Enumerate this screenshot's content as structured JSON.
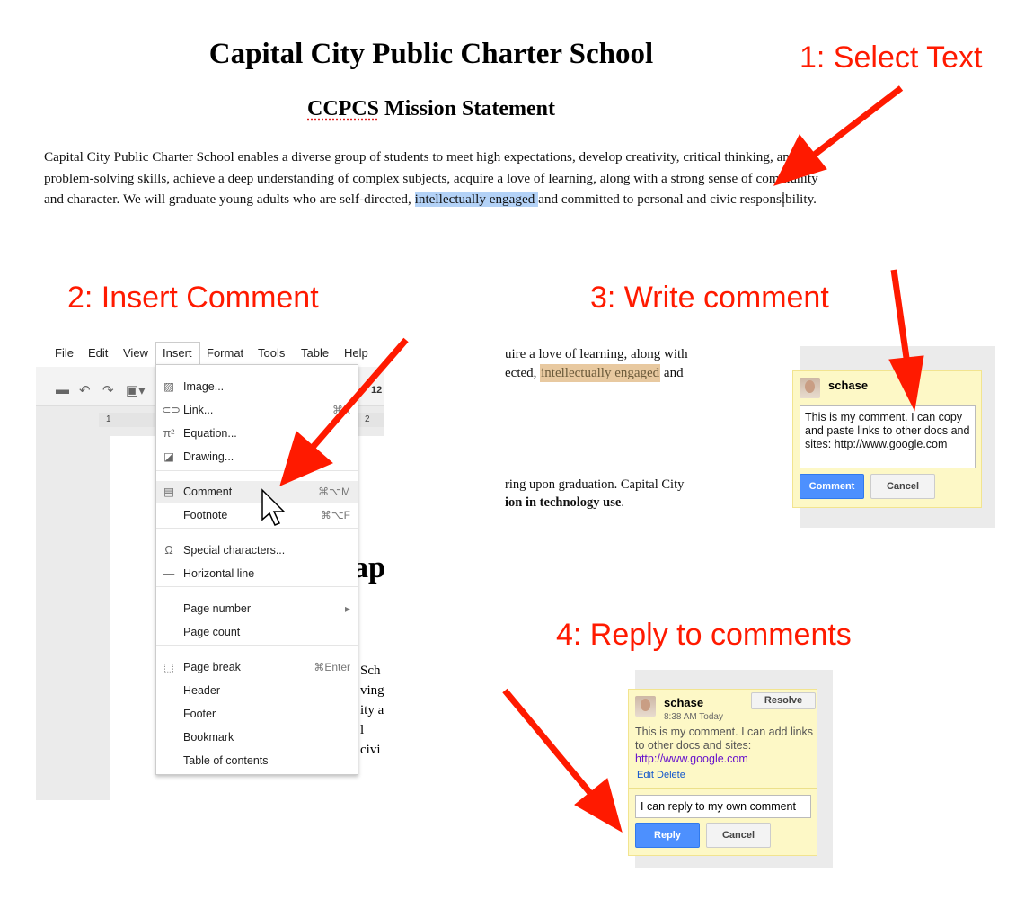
{
  "document": {
    "title": "Capital City Public Charter School",
    "subtitle_prefix": "CCPCS",
    "subtitle_rest": " Mission Statement",
    "paragraph_before": "Capital City Public Charter School enables a diverse group of students to meet high expectations, develop creativity, critical thinking, and problem-solving skills, achieve a deep understanding of complex subjects, acquire a love of learning, along with a strong sense of community and character. We will graduate young adults who are self-directed, ",
    "paragraph_selected": "intellectually engaged ",
    "paragraph_after": "and committed to personal and civic responsibility."
  },
  "steps": {
    "s1": "1: Select Text",
    "s2": "2: Insert Comment",
    "s3": "3: Write comment",
    "s4": "4: Reply to comments"
  },
  "colors": {
    "annotation": "#ff1a00",
    "selection": "#b3d2f7",
    "comment_highlight": "#e8c9a0",
    "comment_card": "#fdf8c6",
    "button_blue": "#4d90fe"
  },
  "menubar": [
    "File",
    "Edit",
    "View",
    "Insert",
    "Format",
    "Tools",
    "Table",
    "Help"
  ],
  "toolbar": {
    "icons": [
      "print-icon",
      "undo-icon",
      "redo-icon",
      "paste-icon"
    ],
    "font_size": "12"
  },
  "ruler": {
    "mark1": "1",
    "mark2": "2"
  },
  "insert_menu": [
    {
      "label": "Image...",
      "icon": "image-icon",
      "shortcut": ""
    },
    {
      "label": "Link...",
      "icon": "link-icon",
      "shortcut": "⌘K"
    },
    {
      "label": "Equation...",
      "icon": "pi-icon",
      "shortcut": ""
    },
    {
      "label": "Drawing...",
      "icon": "drawing-icon",
      "shortcut": ""
    },
    {
      "label": "Comment",
      "icon": "comment-icon",
      "shortcut": "⌘⌥M"
    },
    {
      "label": "Footnote",
      "icon": "",
      "shortcut": "⌘⌥F"
    },
    {
      "label": "Special characters...",
      "icon": "omega-icon",
      "shortcut": ""
    },
    {
      "label": "Horizontal line",
      "icon": "horizontal-line-icon",
      "shortcut": ""
    },
    {
      "label": "Page number",
      "icon": "",
      "shortcut": "▸"
    },
    {
      "label": "Page count",
      "icon": "",
      "shortcut": ""
    },
    {
      "label": "Page break",
      "icon": "page-break-icon",
      "shortcut": "⌘Enter"
    },
    {
      "label": "Header",
      "icon": "",
      "shortcut": ""
    },
    {
      "label": "Footer",
      "icon": "",
      "shortcut": ""
    },
    {
      "label": "Bookmark",
      "icon": "",
      "shortcut": ""
    },
    {
      "label": "Table of contents",
      "icon": "",
      "shortcut": ""
    }
  ],
  "background_doc": {
    "heading_fragment": "ap",
    "lines": [
      "Sch",
      "ving",
      "ity a",
      "l civi"
    ]
  },
  "step3": {
    "line1": "uire a love of learning, along with",
    "line2_before": "ected, ",
    "line2_highlight": "intellectually engaged",
    "line2_after": " and",
    "line3": "ring upon graduation.  Capital City",
    "line4_bold": "ion in technology use",
    "line4_end": ".",
    "user": "schase",
    "comment_text": "This is my comment. I can copy and paste links to other docs and sites: http://www.google.com",
    "comment_button": "Comment",
    "cancel_button": "Cancel"
  },
  "step4": {
    "user": "schase",
    "time": "8:38 AM Today",
    "resolve_button": "Resolve",
    "comment_text": "This is my comment. I can add links to other docs and sites:",
    "link": "http://www.google.com",
    "edit": "Edit",
    "delete": "Delete",
    "reply_value": "I can reply to my own comment",
    "reply_button": "Reply",
    "cancel_button": "Cancel"
  }
}
